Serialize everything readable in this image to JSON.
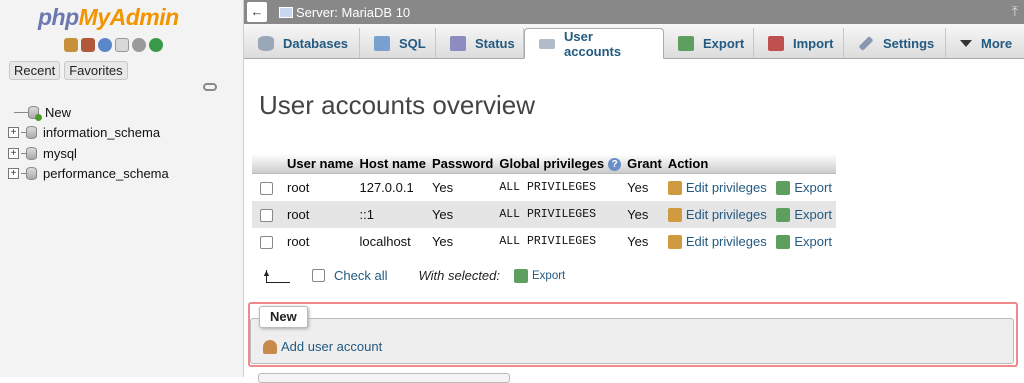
{
  "app": {
    "logo_php": "php",
    "logo_myadmin": "MyAdmin"
  },
  "nav": {
    "tabs": [
      "Recent",
      "Favorites"
    ],
    "tree": [
      {
        "label": "New",
        "expander": ""
      },
      {
        "label": "information_schema",
        "expander": "+"
      },
      {
        "label": "mysql",
        "expander": "+"
      },
      {
        "label": "performance_schema",
        "expander": "+"
      }
    ]
  },
  "serverbar": {
    "back": "←",
    "label": "Server: MariaDB 10",
    "collapse": "⤒"
  },
  "menu": {
    "tabs": [
      {
        "label": "Databases",
        "icon": "database-icon",
        "color": "#9aa7b8"
      },
      {
        "label": "SQL",
        "icon": "sql-icon",
        "color": "#7aa0d0"
      },
      {
        "label": "Status",
        "icon": "status-icon",
        "color": "#8c8cc0"
      },
      {
        "label": "User accounts",
        "icon": "users-icon",
        "color": "#b0bcc8"
      },
      {
        "label": "Export",
        "icon": "export-icon",
        "color": "#5e9e5e"
      },
      {
        "label": "Import",
        "icon": "import-icon",
        "color": "#c05050"
      },
      {
        "label": "Settings",
        "icon": "wrench-icon",
        "color": "#8898b0"
      },
      {
        "label": "More",
        "icon": "triangle-down-icon",
        "color": "#333333"
      }
    ],
    "active": "User accounts"
  },
  "main": {
    "title": "User accounts overview",
    "table": {
      "headers": [
        "User name",
        "Host name",
        "Password",
        "Global privileges",
        "Grant",
        "Action"
      ],
      "rows": [
        {
          "user": "root",
          "host": "127.0.0.1",
          "password": "Yes",
          "privileges": "ALL PRIVILEGES",
          "grant": "Yes",
          "edit": "Edit privileges",
          "export": "Export"
        },
        {
          "user": "root",
          "host": "::1",
          "password": "Yes",
          "privileges": "ALL PRIVILEGES",
          "grant": "Yes",
          "edit": "Edit privileges",
          "export": "Export"
        },
        {
          "user": "root",
          "host": "localhost",
          "password": "Yes",
          "privileges": "ALL PRIVILEGES",
          "grant": "Yes",
          "edit": "Edit privileges",
          "export": "Export"
        }
      ]
    },
    "bulk": {
      "check_all": "Check all",
      "with_selected": "With selected:",
      "export": "Export"
    },
    "new_section": {
      "legend": "New",
      "add_user": "Add user account"
    }
  },
  "colors": {
    "link": "#235a81",
    "accent_orange": "#f29400",
    "highlight_border": "#f08a8a"
  }
}
